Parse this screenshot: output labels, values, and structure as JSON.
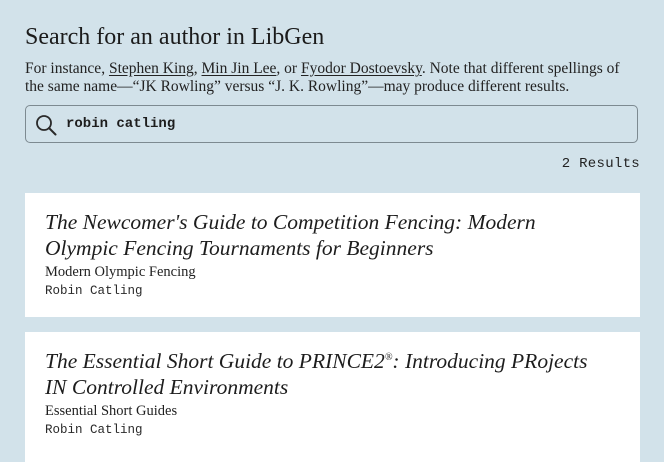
{
  "header": {
    "title": "Search for an author in LibGen"
  },
  "intro": {
    "prefix": "For instance, ",
    "examples": [
      "Stephen King",
      "Min Jin Lee",
      "Fyodor Dostoevsky"
    ],
    "sep1": ", ",
    "sep2": ", or ",
    "suffix": ". Note that different spellings of the same name—“JK Rowling” versus “J. K. Rowling”—may produce different results."
  },
  "search": {
    "value": "robin catling",
    "icon": "search-icon"
  },
  "results": {
    "count_label": "2 Results",
    "items": [
      {
        "title": "The Newcomer's Guide to Competition Fencing: Modern Olympic Fencing Tournaments for Beginners",
        "series": "Modern Olympic Fencing",
        "author": "Robin Catling"
      },
      {
        "title_before": "The Essential Short Guide to PRINCE2",
        "title_sup": "®",
        "title_after": ": Introducing PRojects IN Controlled Environments",
        "series": "Essential Short Guides",
        "author": "Robin Catling"
      }
    ]
  },
  "colors": {
    "background": "#d2e2ea",
    "card": "#ffffff",
    "text": "#1f1f1f"
  }
}
